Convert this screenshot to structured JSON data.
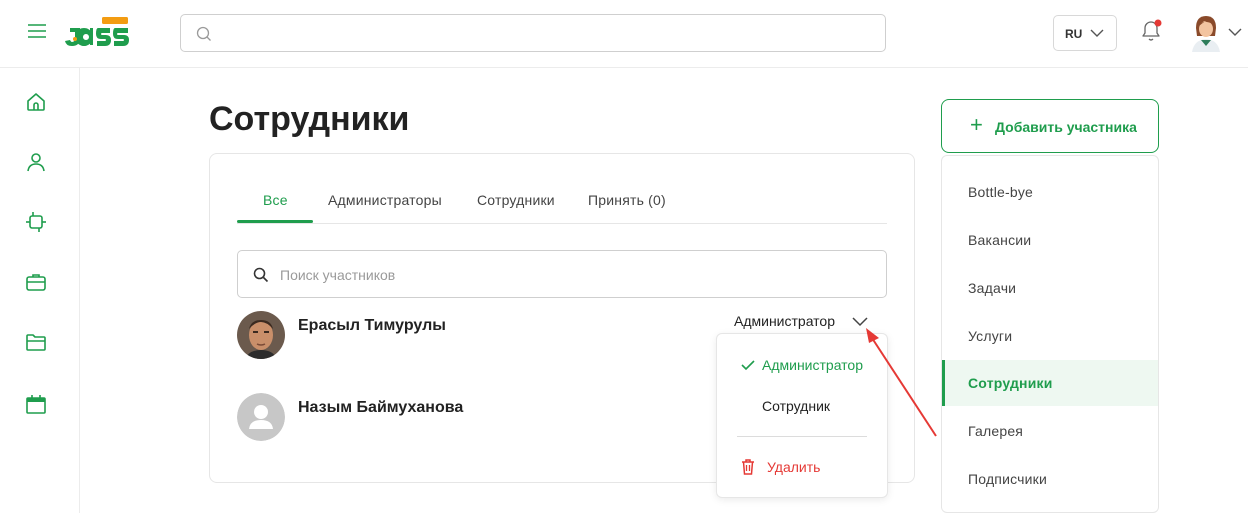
{
  "header": {
    "search_value": "",
    "lang_label": "RU"
  },
  "main": {
    "title": "Сотрудники",
    "tabs": [
      {
        "label": "Все",
        "active": true
      },
      {
        "label": "Администраторы",
        "active": false
      },
      {
        "label": "Сотрудники",
        "active": false
      },
      {
        "label": "Принять (0)",
        "active": false
      }
    ],
    "member_search_placeholder": "Поиск участников",
    "members": [
      {
        "name": "Ерасыл Тимурулы",
        "role": "Администратор"
      },
      {
        "name": "Назым Баймуханова"
      }
    ],
    "role_menu": {
      "selected": "Администратор",
      "option_employee": "Сотрудник",
      "delete": "Удалить"
    }
  },
  "right": {
    "add_button": "Добавить участника",
    "nav": [
      {
        "label": "Bottle-bye",
        "active": false
      },
      {
        "label": "Вакансии",
        "active": false
      },
      {
        "label": "Задачи",
        "active": false
      },
      {
        "label": "Услуги",
        "active": false
      },
      {
        "label": "Сотрудники",
        "active": true
      },
      {
        "label": "Галерея",
        "active": false
      },
      {
        "label": "Подписчики",
        "active": false
      }
    ]
  },
  "colors": {
    "accent": "#1f9d4d",
    "danger": "#e53935",
    "logo_orange": "#f39c12"
  }
}
